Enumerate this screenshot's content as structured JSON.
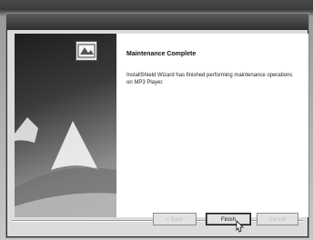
{
  "dialog": {
    "heading": "Maintenance Complete",
    "message": "InstallShield Wizard has finished performing maintenance operations on MP3 Player."
  },
  "buttons": {
    "back_label": "< Back",
    "finish_label": "Finish",
    "cancel_label": "Cancel"
  },
  "icons": {
    "app_icon": "installer-icon",
    "cursor": "mouse-pointer-icon"
  }
}
